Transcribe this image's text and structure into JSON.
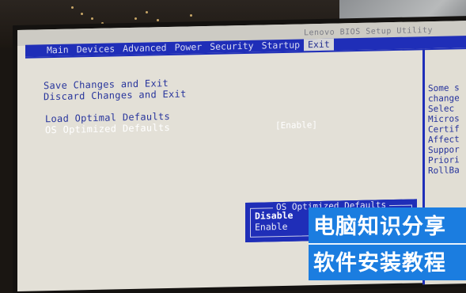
{
  "bios": {
    "title": "Lenovo BIOS Setup Utility",
    "tabs": [
      {
        "label": "Main"
      },
      {
        "label": "Devices"
      },
      {
        "label": "Advanced"
      },
      {
        "label": "Power"
      },
      {
        "label": "Security"
      },
      {
        "label": "Startup"
      },
      {
        "label": "Exit",
        "active": true
      }
    ],
    "menu_items": [
      {
        "label": "Save Changes and Exit"
      },
      {
        "label": "Discard Changes and Exit"
      },
      {
        "label": "Load Optimal Defaults"
      },
      {
        "label": "OS Optimized Defaults",
        "highlighted": true
      }
    ],
    "os_optimized_value": "[Enable]",
    "help_text": [
      "Some s",
      "change",
      " Selec",
      "Micros",
      "Certif",
      "Affect",
      "Suppor",
      "Priori",
      "RollBa"
    ],
    "popup": {
      "title": "OS Optimized Defaults",
      "options": [
        {
          "label": "Disable",
          "selected": true
        },
        {
          "label": "Enable",
          "selected": false
        }
      ]
    },
    "colors": {
      "bios_blue": "#1f2eb8",
      "screen_bg": "#e3e0d7",
      "watermark_bg": "#1b7de0"
    }
  },
  "watermark": {
    "line1": "电脑知识分享",
    "line2": "软件安装教程"
  }
}
